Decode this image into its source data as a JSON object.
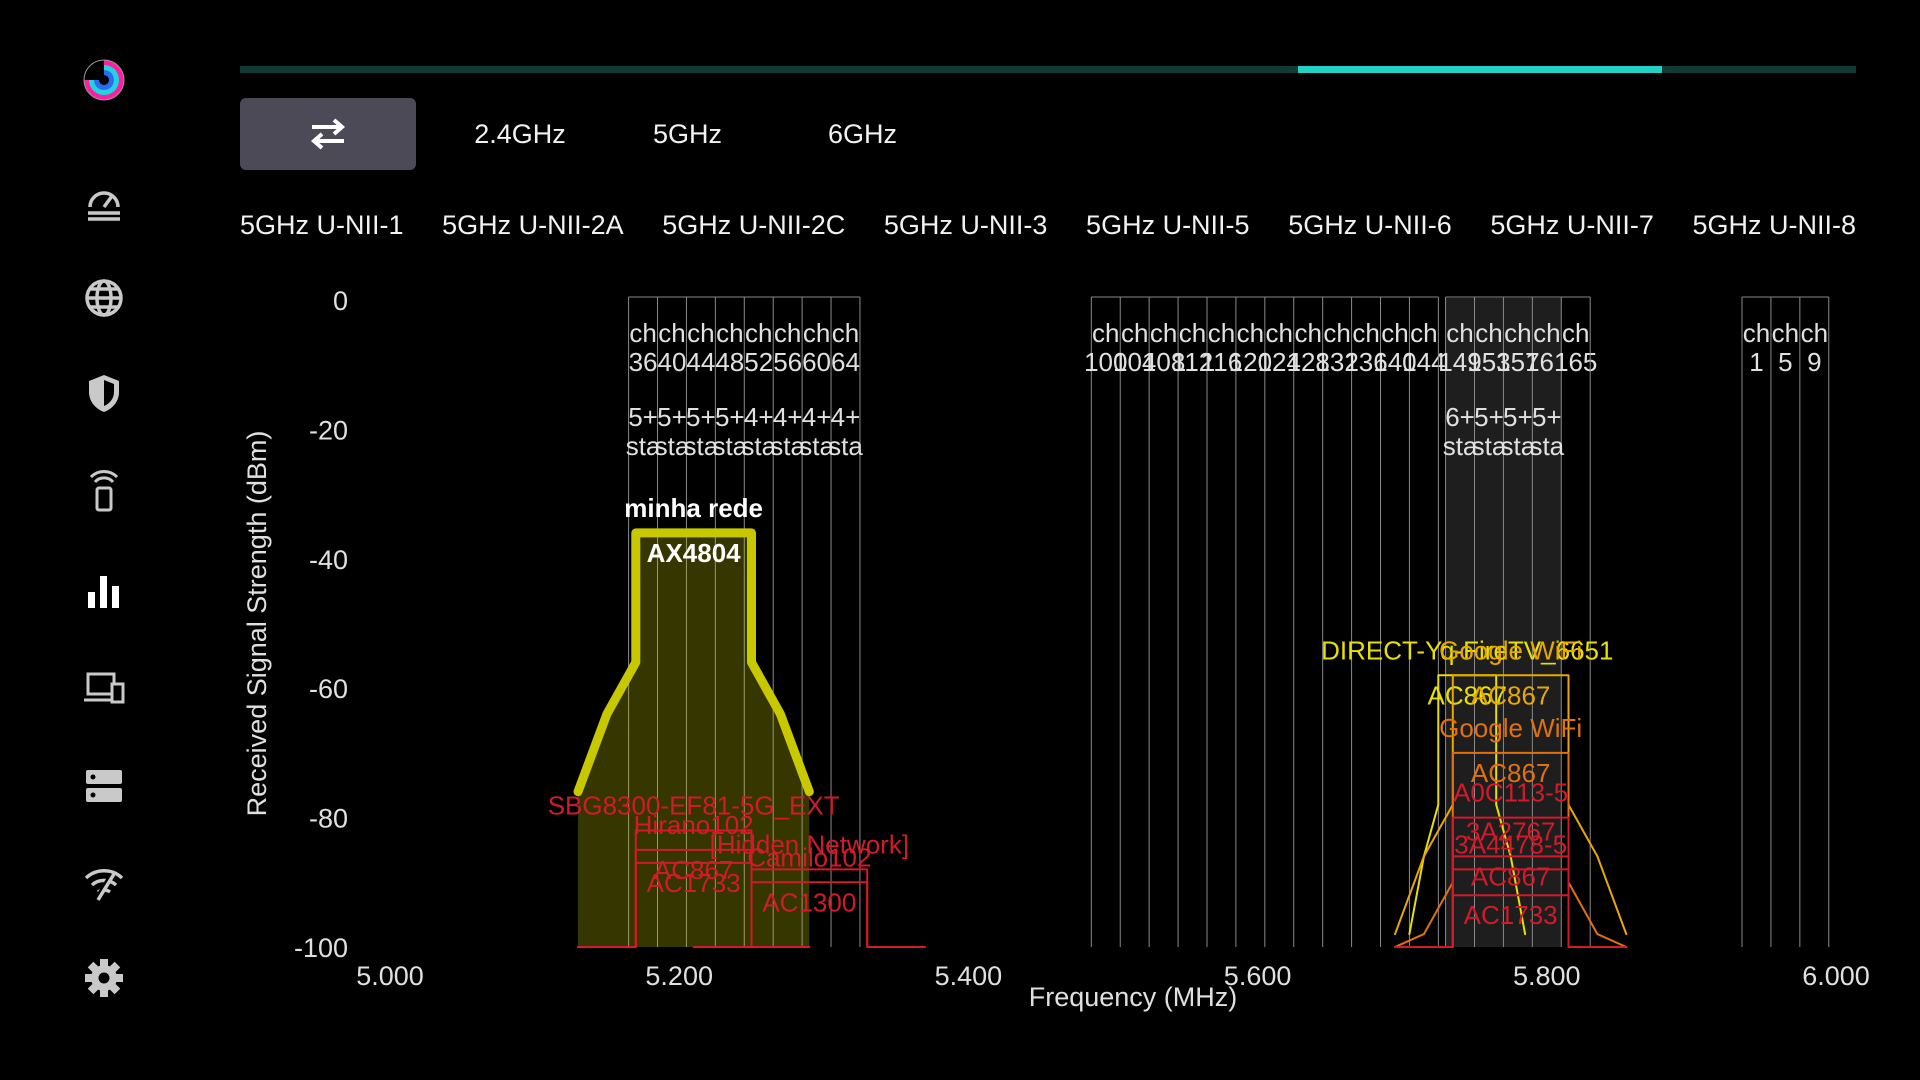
{
  "app": {
    "logo_icon": "wifi-analyzer-logo",
    "accent_color": "#22d2c4",
    "scan_progress": 0.88
  },
  "sidebar": {
    "items": [
      {
        "name": "speedometer-icon"
      },
      {
        "name": "globe-icon"
      },
      {
        "name": "shield-icon"
      },
      {
        "name": "phone-wifi-icon"
      },
      {
        "name": "bar-chart-icon",
        "active": true
      },
      {
        "name": "devices-icon"
      },
      {
        "name": "server-icon"
      },
      {
        "name": "wifi-signal-icon"
      },
      {
        "name": "gear-icon"
      }
    ]
  },
  "band_tabs": {
    "toggle_icon": "swap-arrows-icon",
    "tabs": [
      "2.4GHz",
      "5GHz",
      "6GHz"
    ]
  },
  "subbands": [
    "5GHz U-NII-1",
    "5GHz U-NII-2A",
    "5GHz U-NII-2C",
    "5GHz U-NII-3",
    "5GHz U-NII-5",
    "5GHz U-NII-6",
    "5GHz U-NII-7",
    "5GHz U-NII-8"
  ],
  "chart_data": {
    "type": "area",
    "xlabel": "Frequency (MHz)",
    "ylabel": "Received Signal Strength (dBm)",
    "xlim": [
      5000,
      6000
    ],
    "ylim": [
      -100,
      0
    ],
    "x_ticks": [
      "5.000",
      "5.200",
      "5.400",
      "5.600",
      "5.800",
      "6.000"
    ],
    "x_tick_values": [
      5000,
      5200,
      5400,
      5600,
      5800,
      6000
    ],
    "y_ticks": [
      0,
      -20,
      -40,
      -60,
      -80,
      -100
    ],
    "channel_groups": [
      {
        "channels": [
          {
            "label": "ch",
            "num": "36",
            "freq": 5165
          },
          {
            "label": "ch",
            "num": "40",
            "freq": 5185
          },
          {
            "label": "ch",
            "num": "44",
            "freq": 5205
          },
          {
            "label": "ch",
            "num": "48",
            "freq": 5225
          },
          {
            "label": "ch",
            "num": "52",
            "freq": 5245
          },
          {
            "label": "ch",
            "num": "56",
            "freq": 5265
          },
          {
            "label": "ch",
            "num": "60",
            "freq": 5285
          },
          {
            "label": "ch",
            "num": "64",
            "freq": 5305
          }
        ],
        "end": 5325
      },
      {
        "channels": [
          {
            "label": "ch",
            "num": "100",
            "freq": 5485
          },
          {
            "label": "ch",
            "num": "104",
            "freq": 5505
          },
          {
            "label": "ch",
            "num": "108",
            "freq": 5525
          },
          {
            "label": "ch",
            "num": "112",
            "freq": 5545
          },
          {
            "label": "ch",
            "num": "116",
            "freq": 5565
          },
          {
            "label": "ch",
            "num": "120",
            "freq": 5585
          },
          {
            "label": "ch",
            "num": "124",
            "freq": 5605
          },
          {
            "label": "ch",
            "num": "128",
            "freq": 5625
          },
          {
            "label": "ch",
            "num": "132",
            "freq": 5645
          },
          {
            "label": "ch",
            "num": "136",
            "freq": 5665
          },
          {
            "label": "ch",
            "num": "140",
            "freq": 5685
          },
          {
            "label": "ch",
            "num": "144",
            "freq": 5705
          }
        ],
        "end": 5725
      },
      {
        "channels": [
          {
            "label": "ch",
            "num": "149",
            "freq": 5730
          },
          {
            "label": "ch",
            "num": "153",
            "freq": 5750
          },
          {
            "label": "ch",
            "num": "157",
            "freq": 5770
          },
          {
            "label": "ch",
            "num": "161",
            "freq": 5790
          },
          {
            "label": "ch",
            "num": "165",
            "freq": 5810
          }
        ],
        "end": 5830
      },
      {
        "channels": [
          {
            "label": "ch",
            "num": "1",
            "freq": 5935
          },
          {
            "label": "ch",
            "num": "5",
            "freq": 5955
          },
          {
            "label": "ch",
            "num": "9",
            "freq": 5975
          }
        ],
        "end": 5995
      }
    ],
    "channel_station_counts": [
      {
        "freq": 5165,
        "top": "5+",
        "bottom": "sta"
      },
      {
        "freq": 5185,
        "top": "5+",
        "bottom": "sta"
      },
      {
        "freq": 5205,
        "top": "5+",
        "bottom": "sta"
      },
      {
        "freq": 5225,
        "top": "5+",
        "bottom": "sta"
      },
      {
        "freq": 5245,
        "top": "4+",
        "bottom": "sta"
      },
      {
        "freq": 5265,
        "top": "4+",
        "bottom": "sta"
      },
      {
        "freq": 5285,
        "top": "4+",
        "bottom": "sta"
      },
      {
        "freq": 5305,
        "top": "4+",
        "bottom": "sta"
      },
      {
        "freq": 5730,
        "top": "6+",
        "bottom": "sta"
      },
      {
        "freq": 5750,
        "top": "5+",
        "bottom": "sta"
      },
      {
        "freq": 5770,
        "top": "5+",
        "bottom": "sta"
      },
      {
        "freq": 5790,
        "top": "5+",
        "bottom": "sta"
      }
    ],
    "highlight_ranges": [
      [
        5730,
        5810
      ]
    ],
    "series": [
      {
        "name": "minha rede",
        "subtitle": "AX4804",
        "color": "#c8c800",
        "label_color": "#ffffff",
        "signal": -36,
        "center": 5210,
        "width": 80,
        "fill": true,
        "bold": true
      },
      {
        "name": "SBG8300-EF81-5G_EXT",
        "subtitle": "",
        "color": "#d11a2a",
        "signal": -82,
        "center": 5210,
        "width": 80
      },
      {
        "name": "Hirano102",
        "subtitle": "AC867",
        "color": "#d11a2a",
        "signal": -85,
        "center": 5210,
        "width": 80
      },
      {
        "name": "",
        "subtitle": "AC1733",
        "color": "#d11a2a",
        "signal": -87,
        "center": 5210,
        "width": 80
      },
      {
        "name": "[Hidden Network]",
        "subtitle": "",
        "color": "#d11a2a",
        "signal": -88,
        "center": 5290,
        "width": 80
      },
      {
        "name": "Camilo102",
        "subtitle": "AC1300",
        "color": "#d11a2a",
        "signal": -90,
        "center": 5290,
        "width": 80
      },
      {
        "name": "DIRECT-Yq-FireTV_6651",
        "subtitle": "AC867",
        "color": "#e8e000",
        "signal": -58,
        "center": 5745,
        "width": 40
      },
      {
        "name": "Google WiFi",
        "subtitle": "AC867",
        "color": "#e8a800",
        "signal": -58,
        "center": 5775,
        "width": 80
      },
      {
        "name": "Google WiFi",
        "subtitle": "AC867",
        "color": "#e07010",
        "signal": -70,
        "center": 5775,
        "width": 80
      },
      {
        "name": "A0C113-5",
        "subtitle": "",
        "color": "#d11a2a",
        "signal": -80,
        "center": 5775,
        "width": 80
      },
      {
        "name": "3A2767",
        "subtitle": "AC867",
        "color": "#d11a2a",
        "signal": -86,
        "center": 5775,
        "width": 80
      },
      {
        "name": "3A4478-5",
        "subtitle": "",
        "color": "#d11a2a",
        "signal": -88,
        "center": 5775,
        "width": 80
      },
      {
        "name": "",
        "subtitle": "AC1733",
        "color": "#d11a2a",
        "signal": -92,
        "center": 5775,
        "width": 80
      }
    ]
  }
}
